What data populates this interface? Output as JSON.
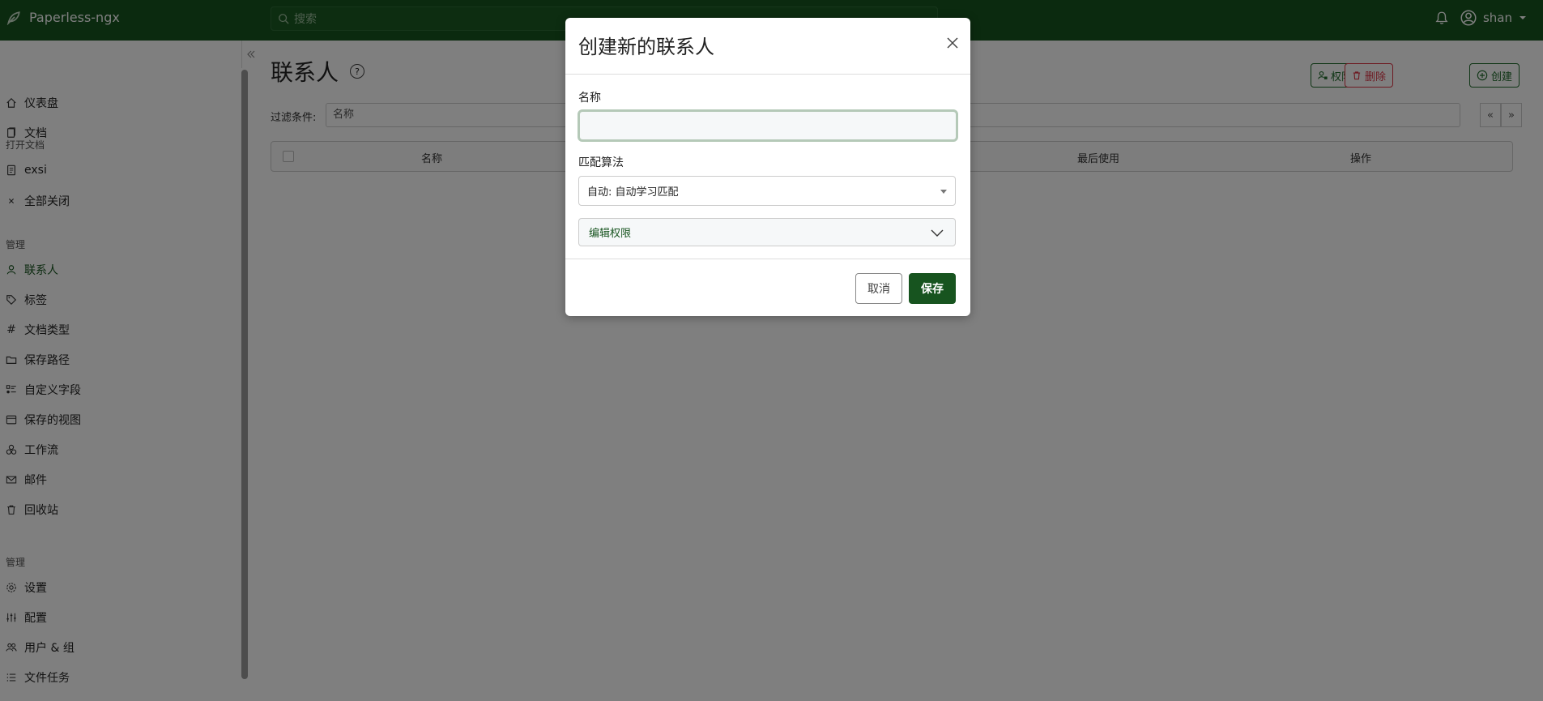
{
  "app": {
    "name": "Paperless-ngx"
  },
  "topbar": {
    "search_placeholder": "搜索",
    "user": "shan"
  },
  "sidebar": {
    "items_main": [
      {
        "label": "仪表盘",
        "icon": "house-icon"
      },
      {
        "label": "文档",
        "icon": "documents-icon"
      }
    ],
    "open_docs_heading": "打开文档",
    "open_docs": [
      {
        "label": "exsi",
        "icon": "file-text-icon"
      },
      {
        "label": "全部关闭",
        "icon": "x-icon"
      }
    ],
    "manage_heading": "管理",
    "manage_items": [
      {
        "label": "联系人",
        "icon": "person-icon",
        "active": true
      },
      {
        "label": "标签",
        "icon": "tags-icon"
      },
      {
        "label": "文档类型",
        "icon": "hash-icon"
      },
      {
        "label": "保存路径",
        "icon": "folder-icon"
      },
      {
        "label": "自定义字段",
        "icon": "ui-checks-icon"
      },
      {
        "label": "保存的视图",
        "icon": "window-icon"
      },
      {
        "label": "工作流",
        "icon": "boxes-icon"
      },
      {
        "label": "邮件",
        "icon": "envelope-icon"
      },
      {
        "label": "回收站",
        "icon": "trash-icon"
      }
    ],
    "admin_heading": "管理",
    "admin_items": [
      {
        "label": "设置",
        "icon": "gear-icon"
      },
      {
        "label": "配置",
        "icon": "sliders-icon"
      },
      {
        "label": "用户 & 组",
        "icon": "people-icon"
      },
      {
        "label": "文件任务",
        "icon": "list-task-icon"
      }
    ]
  },
  "page": {
    "title": "联系人",
    "buttons": {
      "permissions": "权限",
      "delete": "删除",
      "create": "创建"
    },
    "filter_label": "过滤条件:",
    "filter_placeholder": "名称",
    "pager": {
      "prev": "«",
      "next": "»"
    },
    "table_headers": [
      "名称",
      "最后使用",
      "操作"
    ]
  },
  "modal": {
    "title": "创建新的联系人",
    "name_label": "名称",
    "name_value": "",
    "algorithm_label": "匹配算法",
    "algorithm_value": "自动: 自动学习匹配",
    "permissions_accordion": "编辑权限",
    "cancel": "取消",
    "save": "保存"
  },
  "colors": {
    "brand": "#17541f",
    "danger": "#dc3545"
  }
}
